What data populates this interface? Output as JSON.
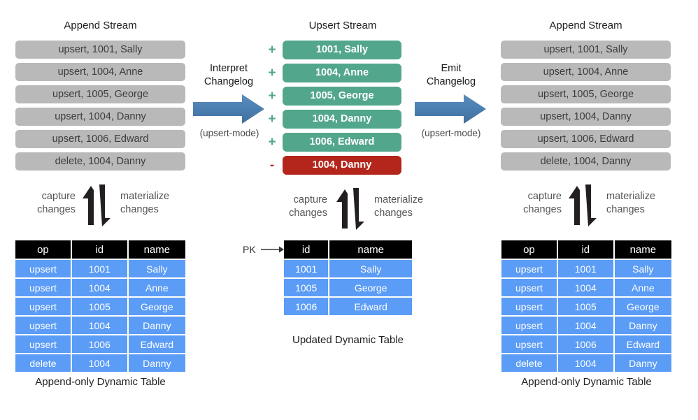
{
  "left": {
    "stream_title": "Append Stream",
    "chips": [
      "upsert, 1001, Sally",
      "upsert, 1004, Anne",
      "upsert, 1005, George",
      "upsert, 1004, Danny",
      "upsert, 1006, Edward",
      "delete, 1004, Danny"
    ],
    "capture_label_line1": "capture",
    "capture_label_line2": "changes",
    "materialize_label_line1": "materialize",
    "materialize_label_line2": "changes",
    "table": {
      "headers": [
        "op",
        "id",
        "name"
      ],
      "rows": [
        [
          "upsert",
          "1001",
          "Sally"
        ],
        [
          "upsert",
          "1004",
          "Anne"
        ],
        [
          "upsert",
          "1005",
          "George"
        ],
        [
          "upsert",
          "1004",
          "Danny"
        ],
        [
          "upsert",
          "1006",
          "Edward"
        ],
        [
          "delete",
          "1004",
          "Danny"
        ]
      ]
    },
    "table_caption": "Append-only Dynamic Table"
  },
  "arrow_left": {
    "title_line1": "Interpret",
    "title_line2": "Changelog",
    "subtitle": "(upsert-mode)",
    "icon": "right-block-arrow"
  },
  "middle": {
    "stream_title": "Upsert Stream",
    "rows": [
      {
        "sign": "+",
        "kind": "insert",
        "text": "1001, Sally"
      },
      {
        "sign": "+",
        "kind": "insert",
        "text": "1004, Anne"
      },
      {
        "sign": "+",
        "kind": "insert",
        "text": "1005, George"
      },
      {
        "sign": "+",
        "kind": "insert",
        "text": "1004, Danny"
      },
      {
        "sign": "+",
        "kind": "insert",
        "text": "1006, Edward"
      },
      {
        "sign": "-",
        "kind": "delete",
        "text": "1004, Danny"
      }
    ],
    "capture_label_line1": "capture",
    "capture_label_line2": "changes",
    "materialize_label_line1": "materialize",
    "materialize_label_line2": "changes",
    "pk_label": "PK",
    "table": {
      "headers": [
        "id",
        "name"
      ],
      "rows": [
        [
          "1001",
          "Sally"
        ],
        [
          "1005",
          "George"
        ],
        [
          "1006",
          "Edward"
        ]
      ]
    },
    "table_caption": "Updated Dynamic Table"
  },
  "arrow_right": {
    "title_line1": "Emit",
    "title_line2": "Changelog",
    "subtitle": "(upsert-mode)",
    "icon": "right-block-arrow"
  },
  "right": {
    "stream_title": "Append Stream",
    "chips": [
      "upsert, 1001, Sally",
      "upsert, 1004, Anne",
      "upsert, 1005, George",
      "upsert, 1004, Danny",
      "upsert, 1006, Edward",
      "delete, 1004, Danny"
    ],
    "capture_label_line1": "capture",
    "capture_label_line2": "changes",
    "materialize_label_line1": "materialize",
    "materialize_label_line2": "changes",
    "table": {
      "headers": [
        "op",
        "id",
        "name"
      ],
      "rows": [
        [
          "upsert",
          "1001",
          "Sally"
        ],
        [
          "upsert",
          "1004",
          "Anne"
        ],
        [
          "upsert",
          "1005",
          "George"
        ],
        [
          "upsert",
          "1004",
          "Danny"
        ],
        [
          "upsert",
          "1006",
          "Edward"
        ],
        [
          "delete",
          "1004",
          "Danny"
        ]
      ]
    },
    "table_caption": "Append-only Dynamic Table"
  },
  "colors": {
    "chip_gray": "#b9b9b9",
    "chip_green": "#52a68c",
    "chip_red": "#b4251b",
    "table_cell_blue": "#5b9cf6",
    "table_header_black": "#000000",
    "arrow_blue": "#4a7fb1"
  }
}
